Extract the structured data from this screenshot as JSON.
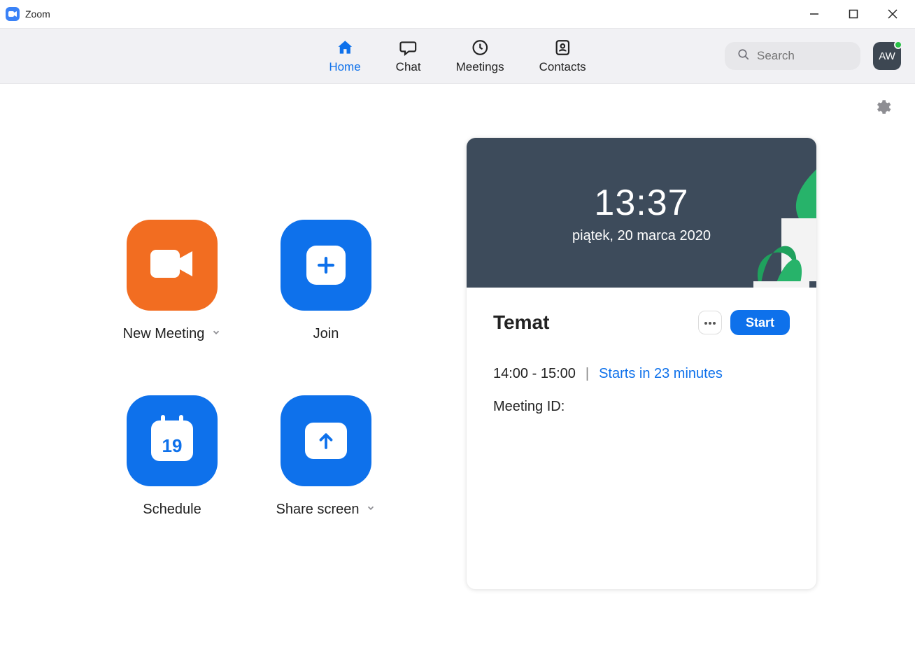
{
  "window": {
    "title": "Zoom"
  },
  "nav": {
    "tabs": [
      {
        "label": "Home",
        "active": true
      },
      {
        "label": "Chat",
        "active": false
      },
      {
        "label": "Meetings",
        "active": false
      },
      {
        "label": "Contacts",
        "active": false
      }
    ],
    "search_placeholder": "Search",
    "avatar_initials": "AW"
  },
  "actions": {
    "new_meeting": "New Meeting",
    "join": "Join",
    "schedule": "Schedule",
    "share_screen": "Share screen",
    "calendar_day": "19"
  },
  "card": {
    "time": "13:37",
    "date": "piątek, 20 marca 2020",
    "topic": "Temat",
    "start_label": "Start",
    "time_range": "14:00 - 15:00",
    "countdown": "Starts in 23 minutes",
    "meeting_id_label": "Meeting ID:"
  }
}
